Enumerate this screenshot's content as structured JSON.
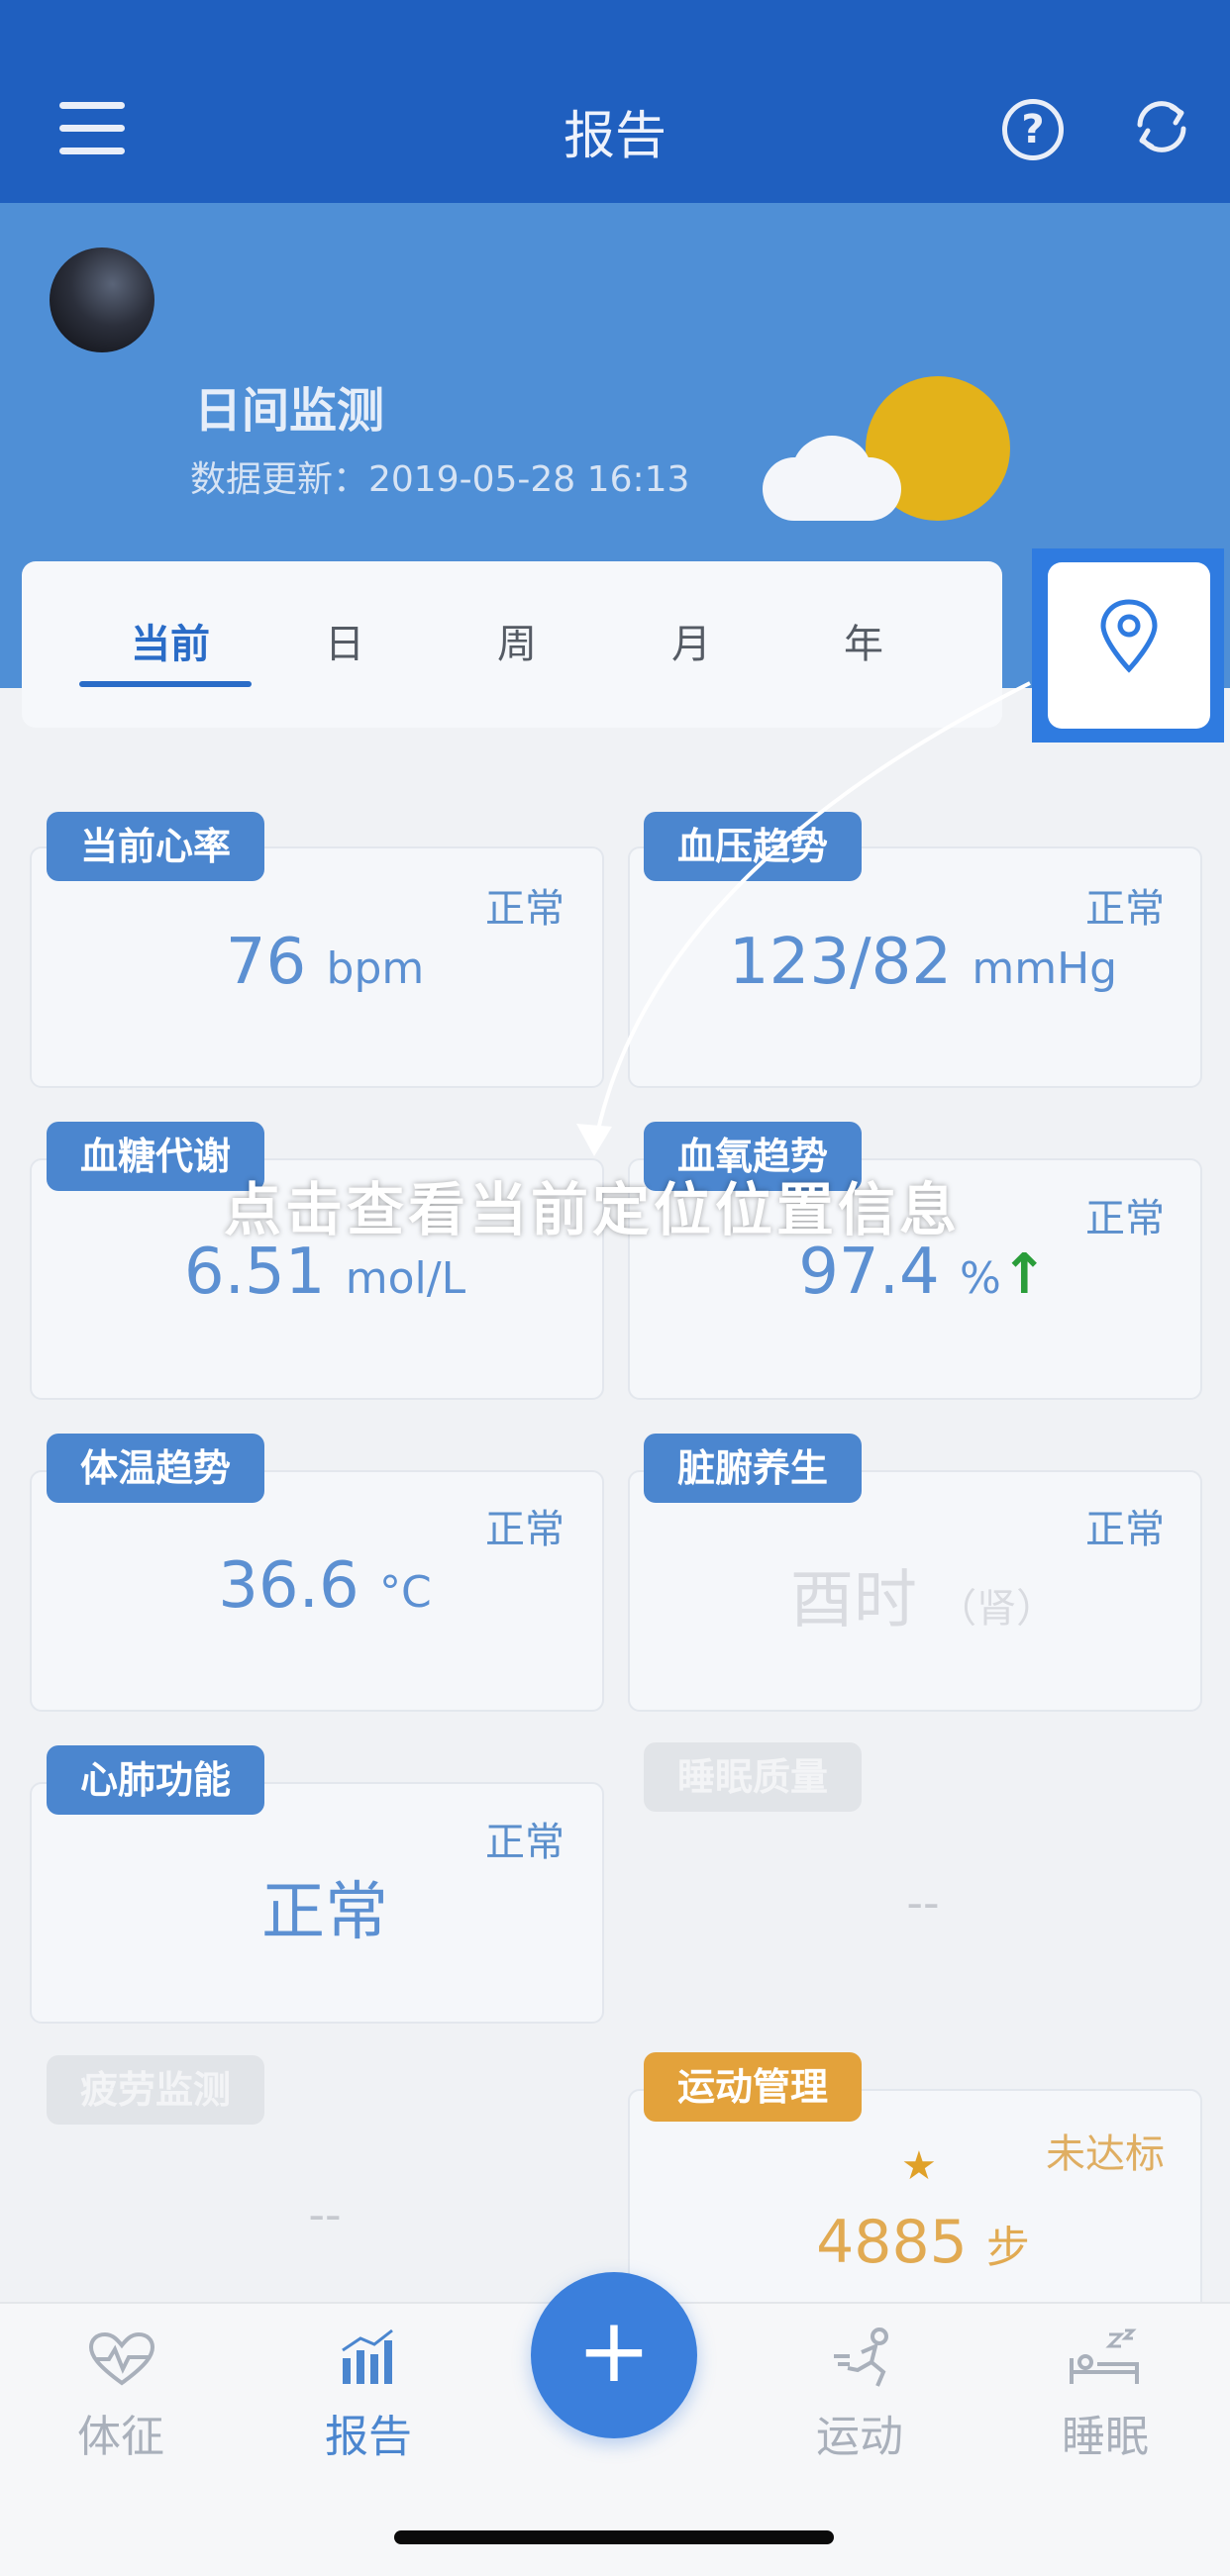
{
  "header": {
    "title": "报告",
    "menu_icon": "hamburger-icon",
    "help_symbol": "?",
    "refresh_icon": "refresh-icon"
  },
  "profile": {
    "title": "日间监测",
    "update_label": "数据更新：2019-05-28 16:13"
  },
  "tabs": [
    "当前",
    "日",
    "周",
    "月",
    "年"
  ],
  "instruction": "点击查看当前定位位置信息",
  "cards": {
    "heart_rate": {
      "badge": "当前心率",
      "status": "正常",
      "value": "76",
      "unit": "bpm"
    },
    "blood_pressure": {
      "badge": "血压趋势",
      "status": "正常",
      "value": "123/82",
      "unit": "mmHg"
    },
    "blood_sugar": {
      "badge": "血糖代谢",
      "value": "6.51",
      "unit": "mol/L"
    },
    "blood_oxygen": {
      "badge": "血氧趋势",
      "status": "正常",
      "value": "97.4",
      "unit": "%",
      "arrow": "↑"
    },
    "temperature": {
      "badge": "体温趋势",
      "status": "正常",
      "value": "36.6",
      "unit": "°C"
    },
    "organ": {
      "badge": "脏腑养生",
      "status": "正常",
      "value": "酉时",
      "unit": "（肾）"
    },
    "cardio": {
      "badge": "心肺功能",
      "status": "正常",
      "value": "正常"
    },
    "sleep_quality": {
      "badge": "睡眠质量",
      "value": "--"
    },
    "fatigue": {
      "badge": "疲劳监测",
      "value": "--"
    },
    "exercise": {
      "badge": "运动管理",
      "status": "未达标",
      "star": "★",
      "value": "4885",
      "unit": "步"
    }
  },
  "bottom_nav": [
    {
      "label": "体征",
      "icon": "heart-pulse-icon"
    },
    {
      "label": "报告",
      "icon": "bar-chart-icon"
    },
    {
      "label": "+",
      "icon": "plus-icon"
    },
    {
      "label": "运动",
      "icon": "running-icon"
    },
    {
      "label": "睡眠",
      "icon": "sleep-bed-icon"
    }
  ],
  "colors": {
    "primary": "#1f5fbf",
    "accent": "#4b86cf",
    "orange": "#e3a23b",
    "up_green": "#2a9d3a"
  }
}
